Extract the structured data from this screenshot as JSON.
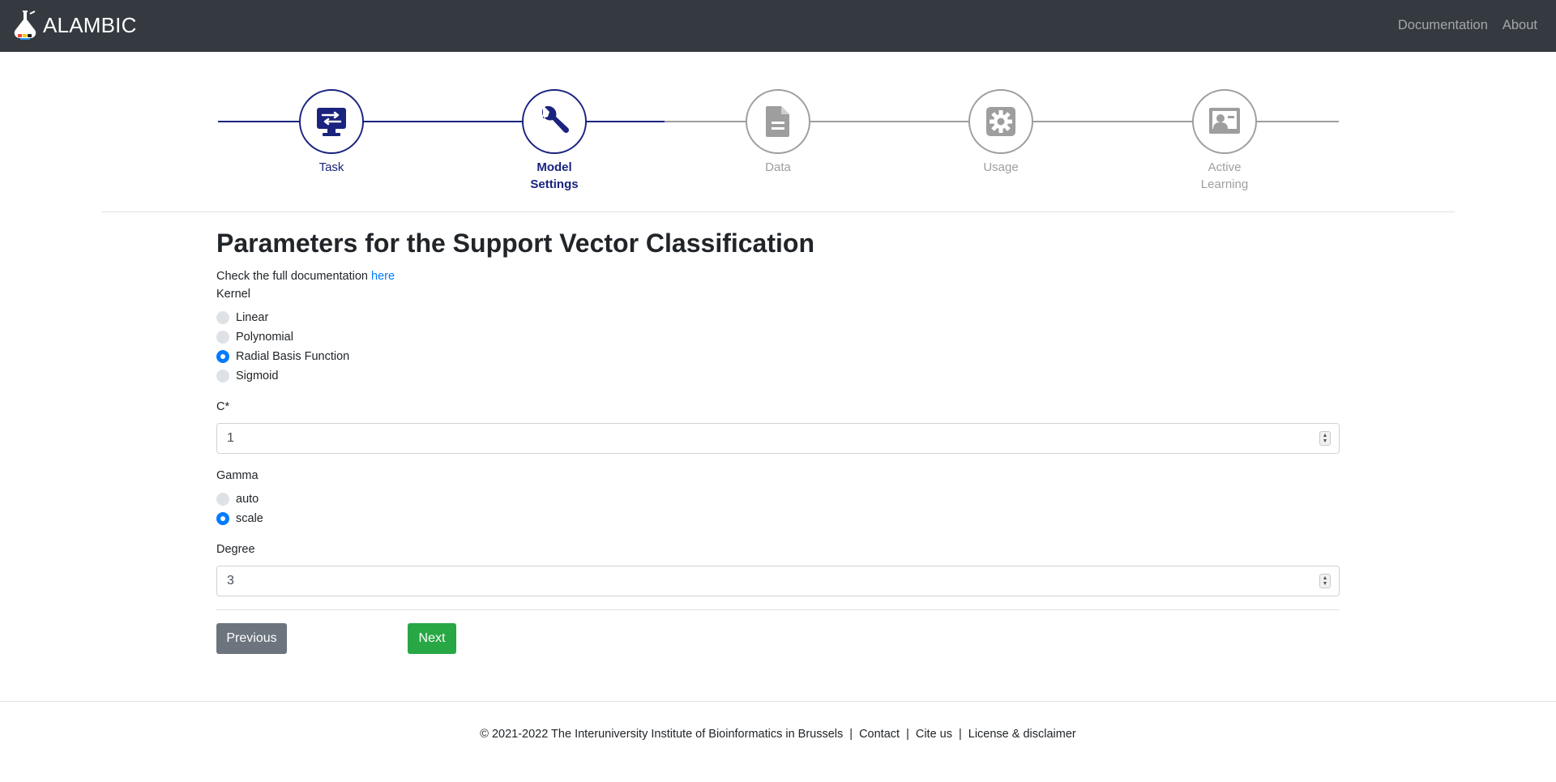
{
  "navbar": {
    "brand": "ALAMBIC",
    "logo_icon": "flask-logo-icon",
    "links": [
      "Documentation",
      "About"
    ]
  },
  "stepper": {
    "active_color": "#1a237e",
    "inactive_color": "#9e9e9e",
    "steps": [
      {
        "label": "Task",
        "icon": "monitor-settings-icon",
        "state": "done"
      },
      {
        "label": "Model Settings",
        "icon": "wrench-icon",
        "state": "current"
      },
      {
        "label": "Data",
        "icon": "document-icon",
        "state": "upcoming"
      },
      {
        "label": "Usage",
        "icon": "gear-icon",
        "state": "upcoming"
      },
      {
        "label": "Active Learning",
        "icon": "teacher-icon",
        "state": "upcoming"
      }
    ]
  },
  "main": {
    "title": "Parameters for the Support Vector Classification",
    "doc_text": "Check the full documentation ",
    "doc_link": "here",
    "kernel": {
      "label": "Kernel",
      "options": [
        "Linear",
        "Polynomial",
        "Radial Basis Function",
        "Sigmoid"
      ],
      "selected": "Radial Basis Function"
    },
    "c": {
      "label": "C*",
      "value": "1"
    },
    "gamma": {
      "label": "Gamma",
      "options": [
        "auto",
        "scale"
      ],
      "selected": "scale"
    },
    "degree": {
      "label": "Degree",
      "value": "3"
    },
    "buttons": {
      "previous": "Previous",
      "next": "Next"
    }
  },
  "footer": {
    "copyright": "© 2021-2022  The Interuniversity Institute of Bioinformatics in Brussels",
    "links": [
      "Contact",
      "Cite us",
      "License & disclaimer"
    ]
  },
  "colors": {
    "navbar_bg": "#343a40",
    "link": "#007bff",
    "primary_radio": "#007bff",
    "btn_previous": "#6c757d",
    "btn_next": "#28a745"
  }
}
